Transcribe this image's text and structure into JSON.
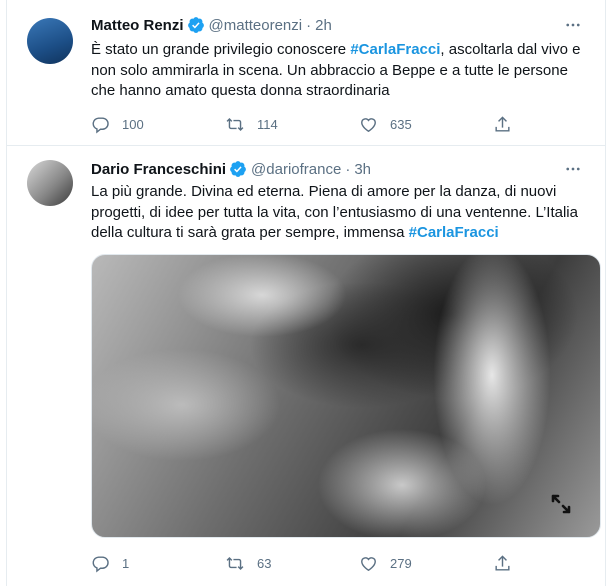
{
  "tweets": [
    {
      "name": "Matteo Renzi",
      "handle": "@matteorenzi",
      "separator": "·",
      "time": "2h",
      "text_before": "È stato un grande privilegio conoscere ",
      "hashtag": "#CarlaFracci",
      "text_after": ", ascoltarla dal vivo e non solo ammirarla in scena. Un abbraccio a Beppe e a tutte le persone che hanno amato questa donna straordinaria",
      "replies": "100",
      "retweets": "114",
      "likes": "635"
    },
    {
      "name": "Dario Franceschini",
      "handle": "@dariofrance",
      "separator": "·",
      "time": "3h",
      "text_before": "La più grande. Divina ed eterna. Piena di amore per la danza, di nuovi progetti, di idee per tutta la vita, con l’entusiasmo di una ventenne. L’Italia della cultura ti sarà grata per sempre, immensa ",
      "hashtag": "#CarlaFracci",
      "text_after": "",
      "replies": "1",
      "retweets": "63",
      "likes": "279"
    }
  ],
  "colors": {
    "hashtag": "#1b95e0",
    "verified": "#1da1f2",
    "muted": "#5b7083",
    "text": "#0f1419",
    "divider": "#e6ecf0"
  },
  "icons": {
    "verified": "verified-badge-icon",
    "more": "more-horizontal-icon",
    "reply": "reply-icon",
    "retweet": "retweet-icon",
    "like": "heart-icon",
    "share": "share-icon",
    "expand": "expand-icon"
  }
}
